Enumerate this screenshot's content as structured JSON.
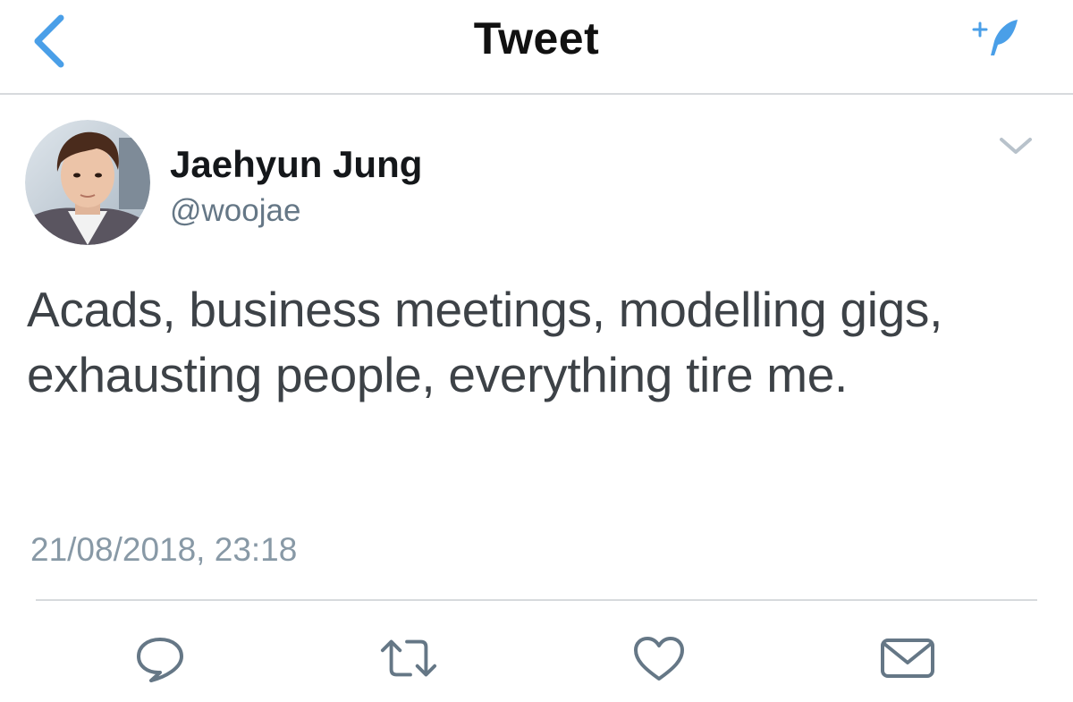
{
  "header": {
    "title": "Tweet",
    "back_icon": "chevron-left-icon",
    "compose_icon": "compose-feather-icon",
    "accent_color": "#4a9fe8"
  },
  "tweet": {
    "author": {
      "name": "Jaehyun Jung",
      "handle": "@woojae"
    },
    "text": "Acads, business meetings, modelling gigs, exhausting people, everything tire me.",
    "timestamp": "21/08/2018, 23:18"
  },
  "actions": [
    {
      "name": "reply",
      "icon": "reply-icon"
    },
    {
      "name": "retweet",
      "icon": "retweet-icon"
    },
    {
      "name": "like",
      "icon": "heart-icon"
    },
    {
      "name": "share",
      "icon": "envelope-icon"
    }
  ]
}
